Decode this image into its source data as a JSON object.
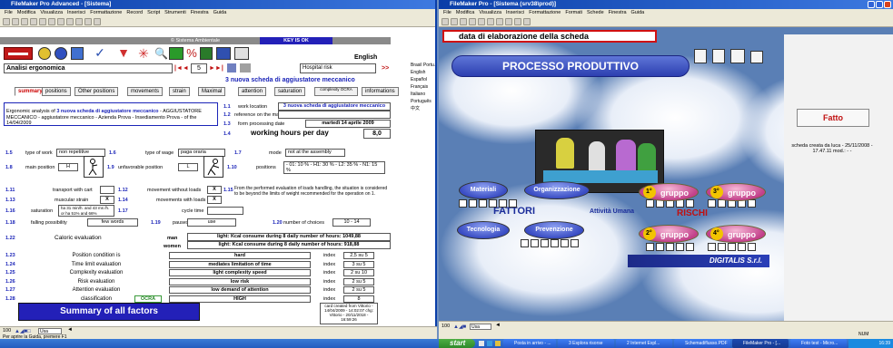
{
  "left_window": {
    "title": "FileMaker Pro Advanced - [Sistema]",
    "menu": [
      "File",
      "Modifica",
      "Visualizza",
      "Inserisci",
      "Formattazione",
      "Record",
      "Script",
      "Strumenti",
      "Finestra",
      "Guida"
    ],
    "header_title": "© Sistema Ambientale",
    "key_status": "KEY IS OK",
    "language": "English",
    "subject_field": "Analisi ergonomica",
    "record_number": "5",
    "hospital_risk": "Hospital risk",
    "hospital_arrow": ">>",
    "record_title": "3 nuova scheda di aggiustatore meccanico",
    "languages": [
      "Brasil Portu.",
      "English",
      "Español",
      "Français",
      "Italiano",
      "Português",
      "中文"
    ],
    "tabs": [
      "summary",
      "positions",
      "Other positions",
      "movements",
      "strain",
      "Maximal",
      "attention",
      "saturation",
      "complexity OCRA",
      "informations"
    ],
    "description": "Ergonomic analysis of 3 nuova scheda di aggiustatore meccanico - AGGIUSTATORE MECCANICO - aggiustatore meccanico - Azienda Prova - Insediamento Prova - of the 14/04/2009",
    "description_prefix": "Ergonomic analysis of ",
    "description_highlight": "3 nuova scheda di aggiustatore meccanico",
    "description_rest": " - AGGIUSTATORE MECCANICO - aggiustatore meccanico - Azienda Prova - Insediamento Prova - of the 14/04/2009",
    "f11": {
      "num": "1.1",
      "label": "work location",
      "value": "3 nuova scheda di aggiustatore meccanico"
    },
    "f12": {
      "num": "1.2",
      "label": "reference on the map",
      "value": ""
    },
    "f13": {
      "num": "1.3",
      "label": "form processing date",
      "value": "martedì 14 aprile 2009"
    },
    "f14": {
      "num": "1.4",
      "label": "working hours per day",
      "value": "8,0"
    },
    "f15": {
      "num": "1.5",
      "label": "type of work",
      "value": "non repetitive"
    },
    "f16": {
      "num": "1.6",
      "label": "type of wage",
      "value": "paga oraria"
    },
    "f17": {
      "num": "1.7",
      "label": "mode",
      "value": "not at the assembly"
    },
    "f18": {
      "num": "1.8",
      "label": "main position",
      "value": "H"
    },
    "f19": {
      "num": "1.9",
      "label": "unfavorable position",
      "value": "L"
    },
    "f110": {
      "num": "1.10",
      "label": "positions",
      "value": "- 01: 10 % - H1: 30 % - L2: 35 % - N1: 15 %"
    },
    "f111": {
      "num": "1.11",
      "label": "transport with cart",
      "value": ""
    },
    "f112": {
      "num": "1.12",
      "label": "movement without loads",
      "value": "X"
    },
    "f113": {
      "num": "1.13",
      "label": "muscular strain",
      "value": "X"
    },
    "f114": {
      "num": "1.14",
      "label": "movements with loads",
      "value": "X"
    },
    "f115": {
      "num": "1.15",
      "text": "From the performed evaluation of loads handling, the situation is considered to be beyond the limits of weight recommended for the operation on 1."
    },
    "f116": {
      "num": "1.16",
      "label": "saturation",
      "value": "ha 31 min/h. and 43 ms /h. or ha 51% and 66%"
    },
    "f117": {
      "num": "1.17",
      "label": "cycle time",
      "value": ""
    },
    "f118": {
      "num": "1.18",
      "label": "falling possibility",
      "value": "few words"
    },
    "f119": {
      "num": "1.19",
      "label": "pauses",
      "value": "use"
    },
    "f120": {
      "num": "1.20",
      "label": "number of choices",
      "value": "10 - 14"
    },
    "f122": {
      "num": "1.22",
      "label": "Caloric evaluation",
      "man": "man",
      "women": "women",
      "man_value": "light: Kcal consume during 8 daily number of hours: 1049,88",
      "women_value": "light: Kcal consume during 8 daily number of hours: 918,88"
    },
    "eval_rows": [
      {
        "num": "1.23",
        "label": "Position condition is",
        "value": "hard",
        "idx": "index",
        "score": "2,5 su 5"
      },
      {
        "num": "1.24",
        "label": "Time limit evaluation",
        "value": "mediates limitation of time",
        "idx": "index",
        "score": "3 su 5"
      },
      {
        "num": "1.25",
        "label": "Complexity evaluation",
        "value": "light complexity speed",
        "idx": "index",
        "score": "2 su 10"
      },
      {
        "num": "1.26",
        "label": "Risk evaluation",
        "value": "low risk",
        "idx": "index",
        "score": "2 su 5"
      },
      {
        "num": "1.27",
        "label": "Attention evaluation",
        "value": "low demand of attention",
        "idx": "index",
        "score": "2 su 5"
      },
      {
        "num": "1.28",
        "label": "classification",
        "ocra": "OCRA",
        "value": "HIGH",
        "idx": "index",
        "score": "8"
      }
    ],
    "summary_button": "Summary of all factors",
    "card_created": "card created from Vittorio - 14/04/2009 - 14:02:07 chg: Vittorio - 20/11/2018 - 16:59:26",
    "status_zoom": "100",
    "status_mode": "Usa",
    "status_bar": "Per aprire la Guida, premere F1"
  },
  "right_window": {
    "title": "FileMaker Pro - [Sistema (srv38\\prod)]",
    "menu": [
      "File",
      "Modifica",
      "Visualizza",
      "Inserisci",
      "Formattazione",
      "Formati",
      "Schede",
      "Finestra",
      "Guida"
    ],
    "date_field": "data di elaborazione della scheda",
    "banner": "PROCESSO PRODUTTIVO",
    "materiali": "Materiali",
    "organizzazione": "Organizzazione",
    "fattori": "FATTORI",
    "attivita": "Attività Umana",
    "rischi": "RISCHI",
    "tecnologia": "Tecnologia",
    "prevenzione": "Prevenzione",
    "gruppi": [
      {
        "n": "1°",
        "label": "gruppo"
      },
      {
        "n": "3°",
        "label": "gruppo"
      },
      {
        "n": "2°",
        "label": "gruppo"
      },
      {
        "n": "4°",
        "label": "gruppo"
      }
    ],
    "logo": "DIGITALIS S.r.l.",
    "fatto_button": "Fatto",
    "creation_note": "scheda creata da luca - 25/11/2008 - 17.47.11 mod.: - -",
    "status_zoom": "100",
    "status_mode": "Usa",
    "status_right": "NUM"
  },
  "taskbar": {
    "start": "start",
    "items": [
      "Posta in arrivo - ...",
      "3 Esplora risorse",
      "2 Internet Expl...",
      "Schemadiflusso.PDF",
      "FileMaker Pro - [...",
      "Foto test - Micro..."
    ],
    "clock": "16:39"
  },
  "colors": {
    "xp_blue": "#2a5bd0",
    "form_bg": "#ffffff",
    "accent_red": "#c00000",
    "panel_blue": "#2320b8"
  }
}
